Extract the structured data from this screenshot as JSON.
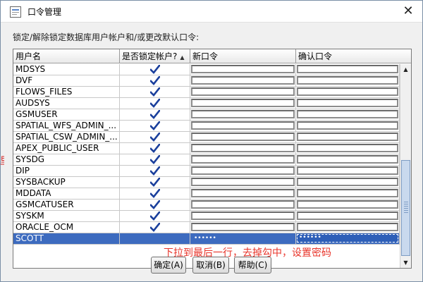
{
  "window": {
    "title": "口令管理",
    "close_glyph": "✕"
  },
  "instruction": "锁定/解除锁定数据库用户帐户和/或更改默认口令:",
  "table": {
    "columns": [
      "用户名",
      "是否锁定帐户?",
      "新口令",
      "确认口令"
    ],
    "sorted_column": "是否锁定帐户?",
    "sort_direction": "ascending",
    "rows": [
      {
        "name": "MDSYS",
        "locked": true,
        "new_password": "",
        "confirm_password": ""
      },
      {
        "name": "DVF",
        "locked": true,
        "new_password": "",
        "confirm_password": ""
      },
      {
        "name": "FLOWS_FILES",
        "locked": true,
        "new_password": "",
        "confirm_password": ""
      },
      {
        "name": "AUDSYS",
        "locked": true,
        "new_password": "",
        "confirm_password": ""
      },
      {
        "name": "GSMUSER",
        "locked": true,
        "new_password": "",
        "confirm_password": ""
      },
      {
        "name": "SPATIAL_WFS_ADMIN_...",
        "locked": true,
        "new_password": "",
        "confirm_password": ""
      },
      {
        "name": "SPATIAL_CSW_ADMIN_...",
        "locked": true,
        "new_password": "",
        "confirm_password": ""
      },
      {
        "name": "APEX_PUBLIC_USER",
        "locked": true,
        "new_password": "",
        "confirm_password": ""
      },
      {
        "name": "SYSDG",
        "locked": true,
        "new_password": "",
        "confirm_password": ""
      },
      {
        "name": "DIP",
        "locked": true,
        "new_password": "",
        "confirm_password": ""
      },
      {
        "name": "SYSBACKUP",
        "locked": true,
        "new_password": "",
        "confirm_password": ""
      },
      {
        "name": "MDDATA",
        "locked": true,
        "new_password": "",
        "confirm_password": ""
      },
      {
        "name": "GSMCATUSER",
        "locked": true,
        "new_password": "",
        "confirm_password": ""
      },
      {
        "name": "SYSKM",
        "locked": true,
        "new_password": "",
        "confirm_password": ""
      },
      {
        "name": "ORACLE_OCM",
        "locked": true,
        "new_password": "",
        "confirm_password": ""
      },
      {
        "name": "SCOTT",
        "locked": false,
        "new_password": "••••••",
        "confirm_password": "••••••",
        "selected": true
      }
    ]
  },
  "scrollbar": {
    "up_glyph": "▲",
    "down_glyph": "▼"
  },
  "annotation": {
    "text": "下拉到最后一行，去掉勾中，设置密码",
    "side_fragment": "里",
    "color": "#e8342a"
  },
  "buttons": {
    "ok": "确定(A)",
    "cancel": "取消(B)",
    "help": "帮助(C)"
  },
  "colors": {
    "selection": "#3d6bbf",
    "checkmark": "#1a3f9c",
    "dialog_bg": "#f0f0f0"
  }
}
